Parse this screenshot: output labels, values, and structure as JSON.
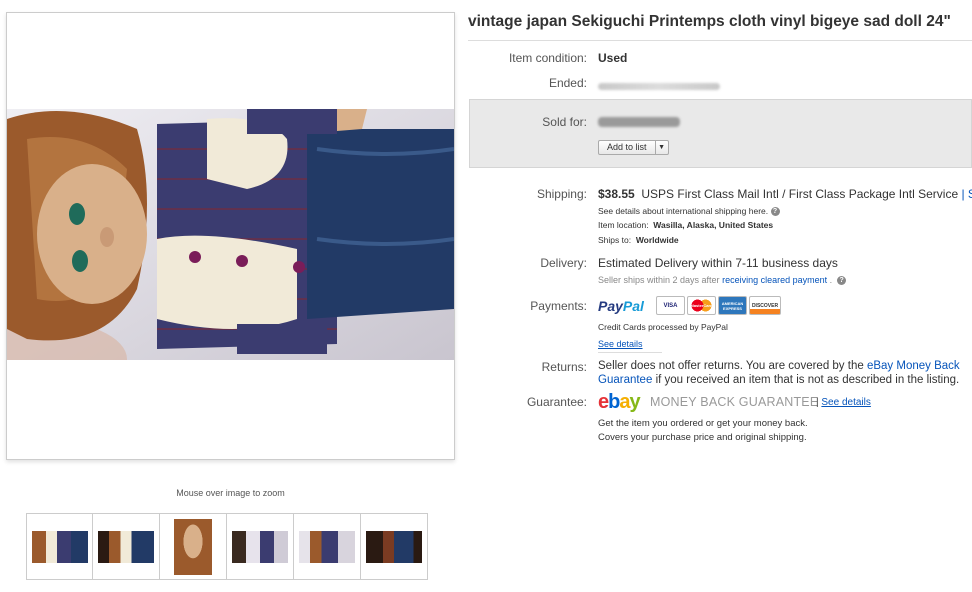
{
  "listing": {
    "title": "vintage japan Sekiguchi Printemps cloth vinyl bigeye sad doll 24\"",
    "zoom_hint": "Mouse over image to zoom",
    "thumbnails": [
      "thumb-1",
      "thumb-2",
      "thumb-3",
      "thumb-4",
      "thumb-5",
      "thumb-6"
    ]
  },
  "details": {
    "condition_label": "Item condition:",
    "condition_value": "Used",
    "ended_label": "Ended:",
    "sold_label": "Sold for:",
    "add_to_list": "Add to list",
    "shipping_label": "Shipping:",
    "shipping_price": "$38.55",
    "shipping_service": "USPS First Class Mail Intl / First Class Package Intl Service",
    "shipping_see": "| See",
    "shipping_details_note": "See details about international shipping here.",
    "item_location_label": "Item location:",
    "item_location_value": "Wasilla, Alaska, United States",
    "ships_to_label": "Ships to:",
    "ships_to_value": "Worldwide",
    "delivery_label": "Delivery:",
    "delivery_value": "Estimated Delivery within 7-11 business days",
    "seller_ships_prefix": "Seller ships within 2 days after",
    "seller_ships_link": "receiving cleared payment",
    "seller_ships_suffix": ".",
    "payments_label": "Payments:",
    "paypal_pay": "Pay",
    "paypal_pal": "Pal",
    "cards": [
      "VISA",
      "MasterCard",
      "AMERICAN EXPRESS",
      "DISCOVER"
    ],
    "credit_note": "Credit Cards processed by PayPal",
    "see_details": "See details",
    "returns_label": "Returns:",
    "returns_text_1": "Seller does not offer returns. You are covered by the",
    "returns_link_1": "eBay Money Back",
    "returns_link_2": "Guarantee",
    "returns_text_2": "if you received an item that is not as described in the listing.",
    "guarantee_label": "Guarantee:",
    "ebay_e": "e",
    "ebay_b": "b",
    "ebay_a": "a",
    "ebay_y": "y",
    "mbg_text": "MONEY BACK GUARANTEE",
    "guarantee_sep": "|",
    "guarantee_see_details": "See details",
    "guarantee_line_1": "Get the item you ordered or get your money back.",
    "guarantee_line_2": "Covers your purchase price and original shipping."
  },
  "colors": {
    "link": "#0654ba",
    "paypal_dark": "#253b80",
    "paypal_light": "#179bd7",
    "ebay_red": "#e53238",
    "ebay_blue": "#0064d2",
    "ebay_yellow": "#f5af02",
    "ebay_green": "#86b817"
  }
}
